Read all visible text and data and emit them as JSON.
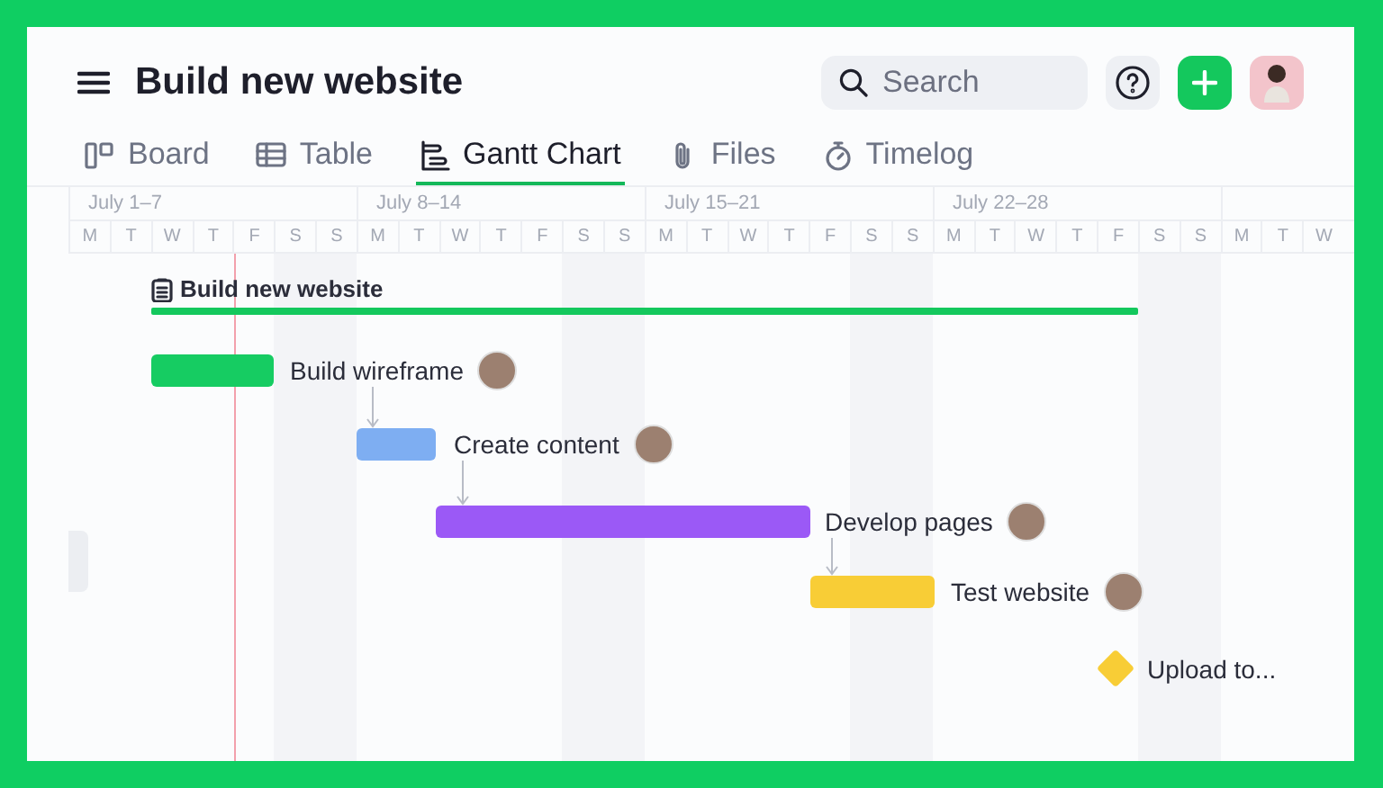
{
  "header": {
    "title": "Build new website",
    "search": {
      "placeholder": "Search"
    }
  },
  "tabs": [
    {
      "label": "Board",
      "kind": "board",
      "selected": false
    },
    {
      "label": "Table",
      "kind": "table",
      "selected": false
    },
    {
      "label": "Gantt Chart",
      "kind": "gantt",
      "selected": true
    },
    {
      "label": "Files",
      "kind": "files",
      "selected": false
    },
    {
      "label": "Timelog",
      "kind": "timelog",
      "selected": false
    }
  ],
  "timeline": {
    "weeks": [
      "July 1–7",
      "July 8–14",
      "July 15–21",
      "July 22–28"
    ],
    "days": [
      "M",
      "T",
      "W",
      "T",
      "F",
      "S",
      "S",
      "M",
      "T",
      "W",
      "T",
      "F",
      "S",
      "S",
      "M",
      "T",
      "W",
      "T",
      "F",
      "S",
      "S",
      "M",
      "T",
      "W",
      "T",
      "F",
      "S",
      "S",
      "M",
      "T",
      "W"
    ]
  },
  "project": {
    "name": "Build new website"
  },
  "tasks": [
    {
      "name": "Build wireframe",
      "kind": "bar",
      "color": "#16cc62"
    },
    {
      "name": "Create content",
      "kind": "bar",
      "color": "#7eaef2"
    },
    {
      "name": "Develop pages",
      "kind": "bar",
      "color": "#9b59f6"
    },
    {
      "name": "Test website",
      "kind": "bar",
      "color": "#f8cd36"
    },
    {
      "name": "Upload to...",
      "kind": "milestone",
      "color": "#f8cd36"
    }
  ]
}
